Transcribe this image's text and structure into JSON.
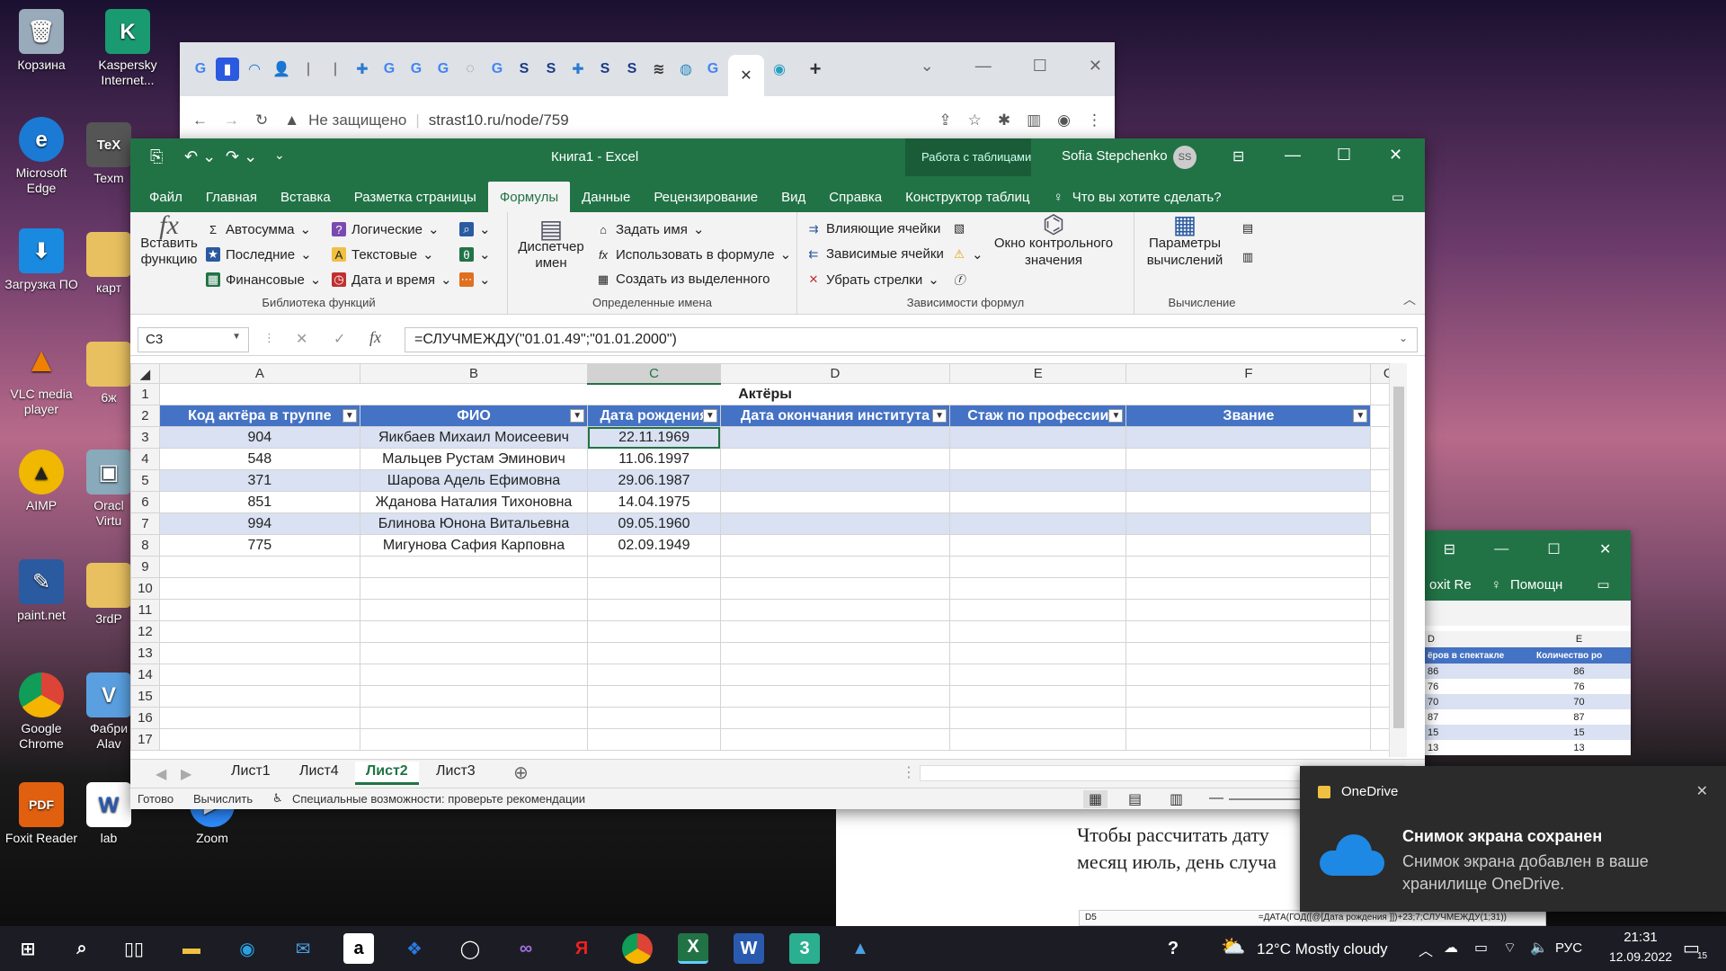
{
  "desktop": {
    "icons": [
      {
        "label": "Корзина"
      },
      {
        "label": "Kaspersky Internet..."
      },
      {
        "label": "Microsoft Edge"
      },
      {
        "label": "Texm"
      },
      {
        "label": "Загрузка ПО"
      },
      {
        "label": "карт"
      },
      {
        "label": "VLC media player"
      },
      {
        "label": "6ж"
      },
      {
        "label": "AIMP"
      },
      {
        "label": "Oracl Virtu"
      },
      {
        "label": "paint.net"
      },
      {
        "label": "3rdP"
      },
      {
        "label": "Google Chrome"
      },
      {
        "label": "Фабри Alav"
      },
      {
        "label": "Foxit Reader"
      },
      {
        "label": "lab"
      },
      {
        "label": "Zoom"
      }
    ]
  },
  "chrome": {
    "security": "Не защищено",
    "url": "strast10.ru/node/759"
  },
  "excel": {
    "title": "Книга1 - Excel",
    "context": "Работа с таблицами",
    "user": "Sofia Stepchenko",
    "user_initials": "SS",
    "menu": [
      "Файл",
      "Главная",
      "Вставка",
      "Разметка страницы",
      "Формулы",
      "Данные",
      "Рецензирование",
      "Вид",
      "Справка",
      "Конструктор таблиц"
    ],
    "tell_me": "Что вы хотите сделать?",
    "ribbon": {
      "insert_function": "Вставить функцию",
      "autosum": "Автосумма",
      "recent": "Последние",
      "financial": "Финансовые",
      "logical": "Логические",
      "text": "Текстовые",
      "datetime": "Дата и время",
      "library_label": "Библиотека функций",
      "name_manager": "Диспетчер имен",
      "define_name": "Задать имя",
      "use_in_formula": "Использовать в формуле",
      "create_from_selection": "Создать из выделенного",
      "names_label": "Определенные имена",
      "trace_precedents": "Влияющие ячейки",
      "trace_dependents": "Зависимые ячейки",
      "remove_arrows": "Убрать стрелки",
      "watch_window": "Окно контрольного значения",
      "auditing_label": "Зависимости формул",
      "calc_options": "Параметры вычислений",
      "calc_label": "Вычисление"
    },
    "name_box": "C3",
    "formula": "=СЛУЧМЕЖДУ(\"01.01.49\";\"01.01.2000\")",
    "columns": [
      "A",
      "B",
      "C",
      "D",
      "E",
      "F",
      "G"
    ],
    "sheet_title": "Актёры",
    "headers": [
      "Код актёра в труппе",
      "ФИО",
      "Дата рождения",
      "Дата окончания института",
      "Стаж по профессии",
      "Звание"
    ],
    "rows": [
      {
        "n": "3",
        "code": "904",
        "name": "Яикбаев Михаил Моисеевич",
        "dob": "22.11.1969"
      },
      {
        "n": "4",
        "code": "548",
        "name": "Мальцев Рустам Эминович",
        "dob": "11.06.1997"
      },
      {
        "n": "5",
        "code": "371",
        "name": "Шарова Адель Ефимовна",
        "dob": "29.06.1987"
      },
      {
        "n": "6",
        "code": "851",
        "name": "Жданова Наталия Тихоновна",
        "dob": "14.04.1975"
      },
      {
        "n": "7",
        "code": "994",
        "name": "Блинова Юнона Витальевна",
        "dob": "09.05.1960"
      },
      {
        "n": "8",
        "code": "775",
        "name": "Мигунова Сафия Карповна",
        "dob": "02.09.1949"
      }
    ],
    "empty_rows": [
      "9",
      "10",
      "11",
      "12",
      "13",
      "14",
      "15",
      "16",
      "17"
    ],
    "sheets": [
      "Лист1",
      "Лист4",
      "Лист2",
      "Лист3"
    ],
    "active_sheet": "Лист2",
    "status_ready": "Готово",
    "status_calc": "Вычислить",
    "status_access": "Специальные возможности: проверьте рекомендации"
  },
  "excel2": {
    "tab": "oxit Re",
    "help": "Помощн",
    "col_d": "D",
    "col_e": "E",
    "hdr_d": "ёров в спектакле",
    "hdr_e": "Количество ро",
    "values": [
      [
        "86",
        "86"
      ],
      [
        "76",
        "76"
      ],
      [
        "70",
        "70"
      ],
      [
        "87",
        "87"
      ],
      [
        "15",
        "15"
      ],
      [
        "13",
        "13"
      ]
    ]
  },
  "word": {
    "line1": "Чтобы рассчитать дату",
    "line2": "месяц июль, день случа",
    "mini_namebox": "D5",
    "mini_formula": "=ДАТА(ГОД([@[Дата рождения ]])+23;7;СЛУЧМЕЖДУ(1;31))"
  },
  "toast": {
    "app": "OneDrive",
    "title": "Снимок экрана сохранен",
    "body": "Снимок экрана добавлен в ваше хранилище OneDrive."
  },
  "taskbar": {
    "weather": "12°C  Mostly cloudy",
    "lang": "РУС",
    "time": "21:31",
    "date": "12.09.2022",
    "notif": "15"
  },
  "colors": {
    "excel_green": "#217346",
    "table_header": "#4472c4",
    "band": "#d9e1f2"
  }
}
